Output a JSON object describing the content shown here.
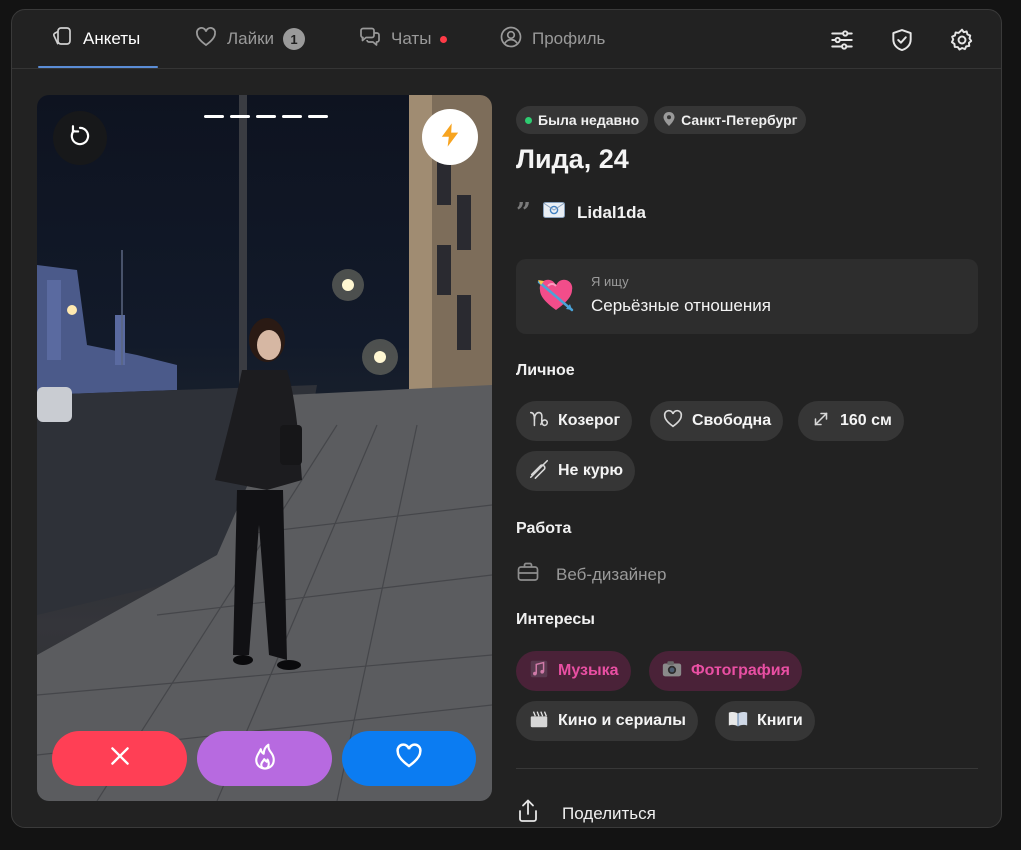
{
  "nav": {
    "tabs": [
      {
        "label": "Анкеты",
        "active": true
      },
      {
        "label": "Лайки",
        "badge": "1"
      },
      {
        "label": "Чаты",
        "unread_dot": true
      },
      {
        "label": "Профиль"
      }
    ],
    "icons": [
      "filters-icon",
      "shield-check-icon",
      "settings-gear-icon"
    ]
  },
  "photo": {
    "total_photos": 5,
    "actions": [
      "dislike-x-icon",
      "super-like-flame-icon",
      "like-heart-icon"
    ]
  },
  "profile": {
    "status": "Была недавно",
    "city": "Санкт-Петербург",
    "name": "Лида, 24",
    "social": "Lidal1da",
    "seeking_label": "Я ищу",
    "seeking_value": "Серьёзные отношения",
    "personal_title": "Личное",
    "personal": [
      "Козерог",
      "Свободна",
      "160 см",
      "Не курю"
    ],
    "work_title": "Работа",
    "job": "Веб-дизайнер",
    "interests_title": "Интересы",
    "interests": [
      "Музыка",
      "Фотография",
      "Кино и сериалы",
      "Книги"
    ],
    "share": "Поделиться"
  },
  "colors": {
    "accent": "#5b8dd6",
    "dislike": "#ff3f55",
    "super": "#b76ae0",
    "like": "#0b7cf2",
    "online": "#2ecc71",
    "interest_highlight": "#e94fa3"
  }
}
